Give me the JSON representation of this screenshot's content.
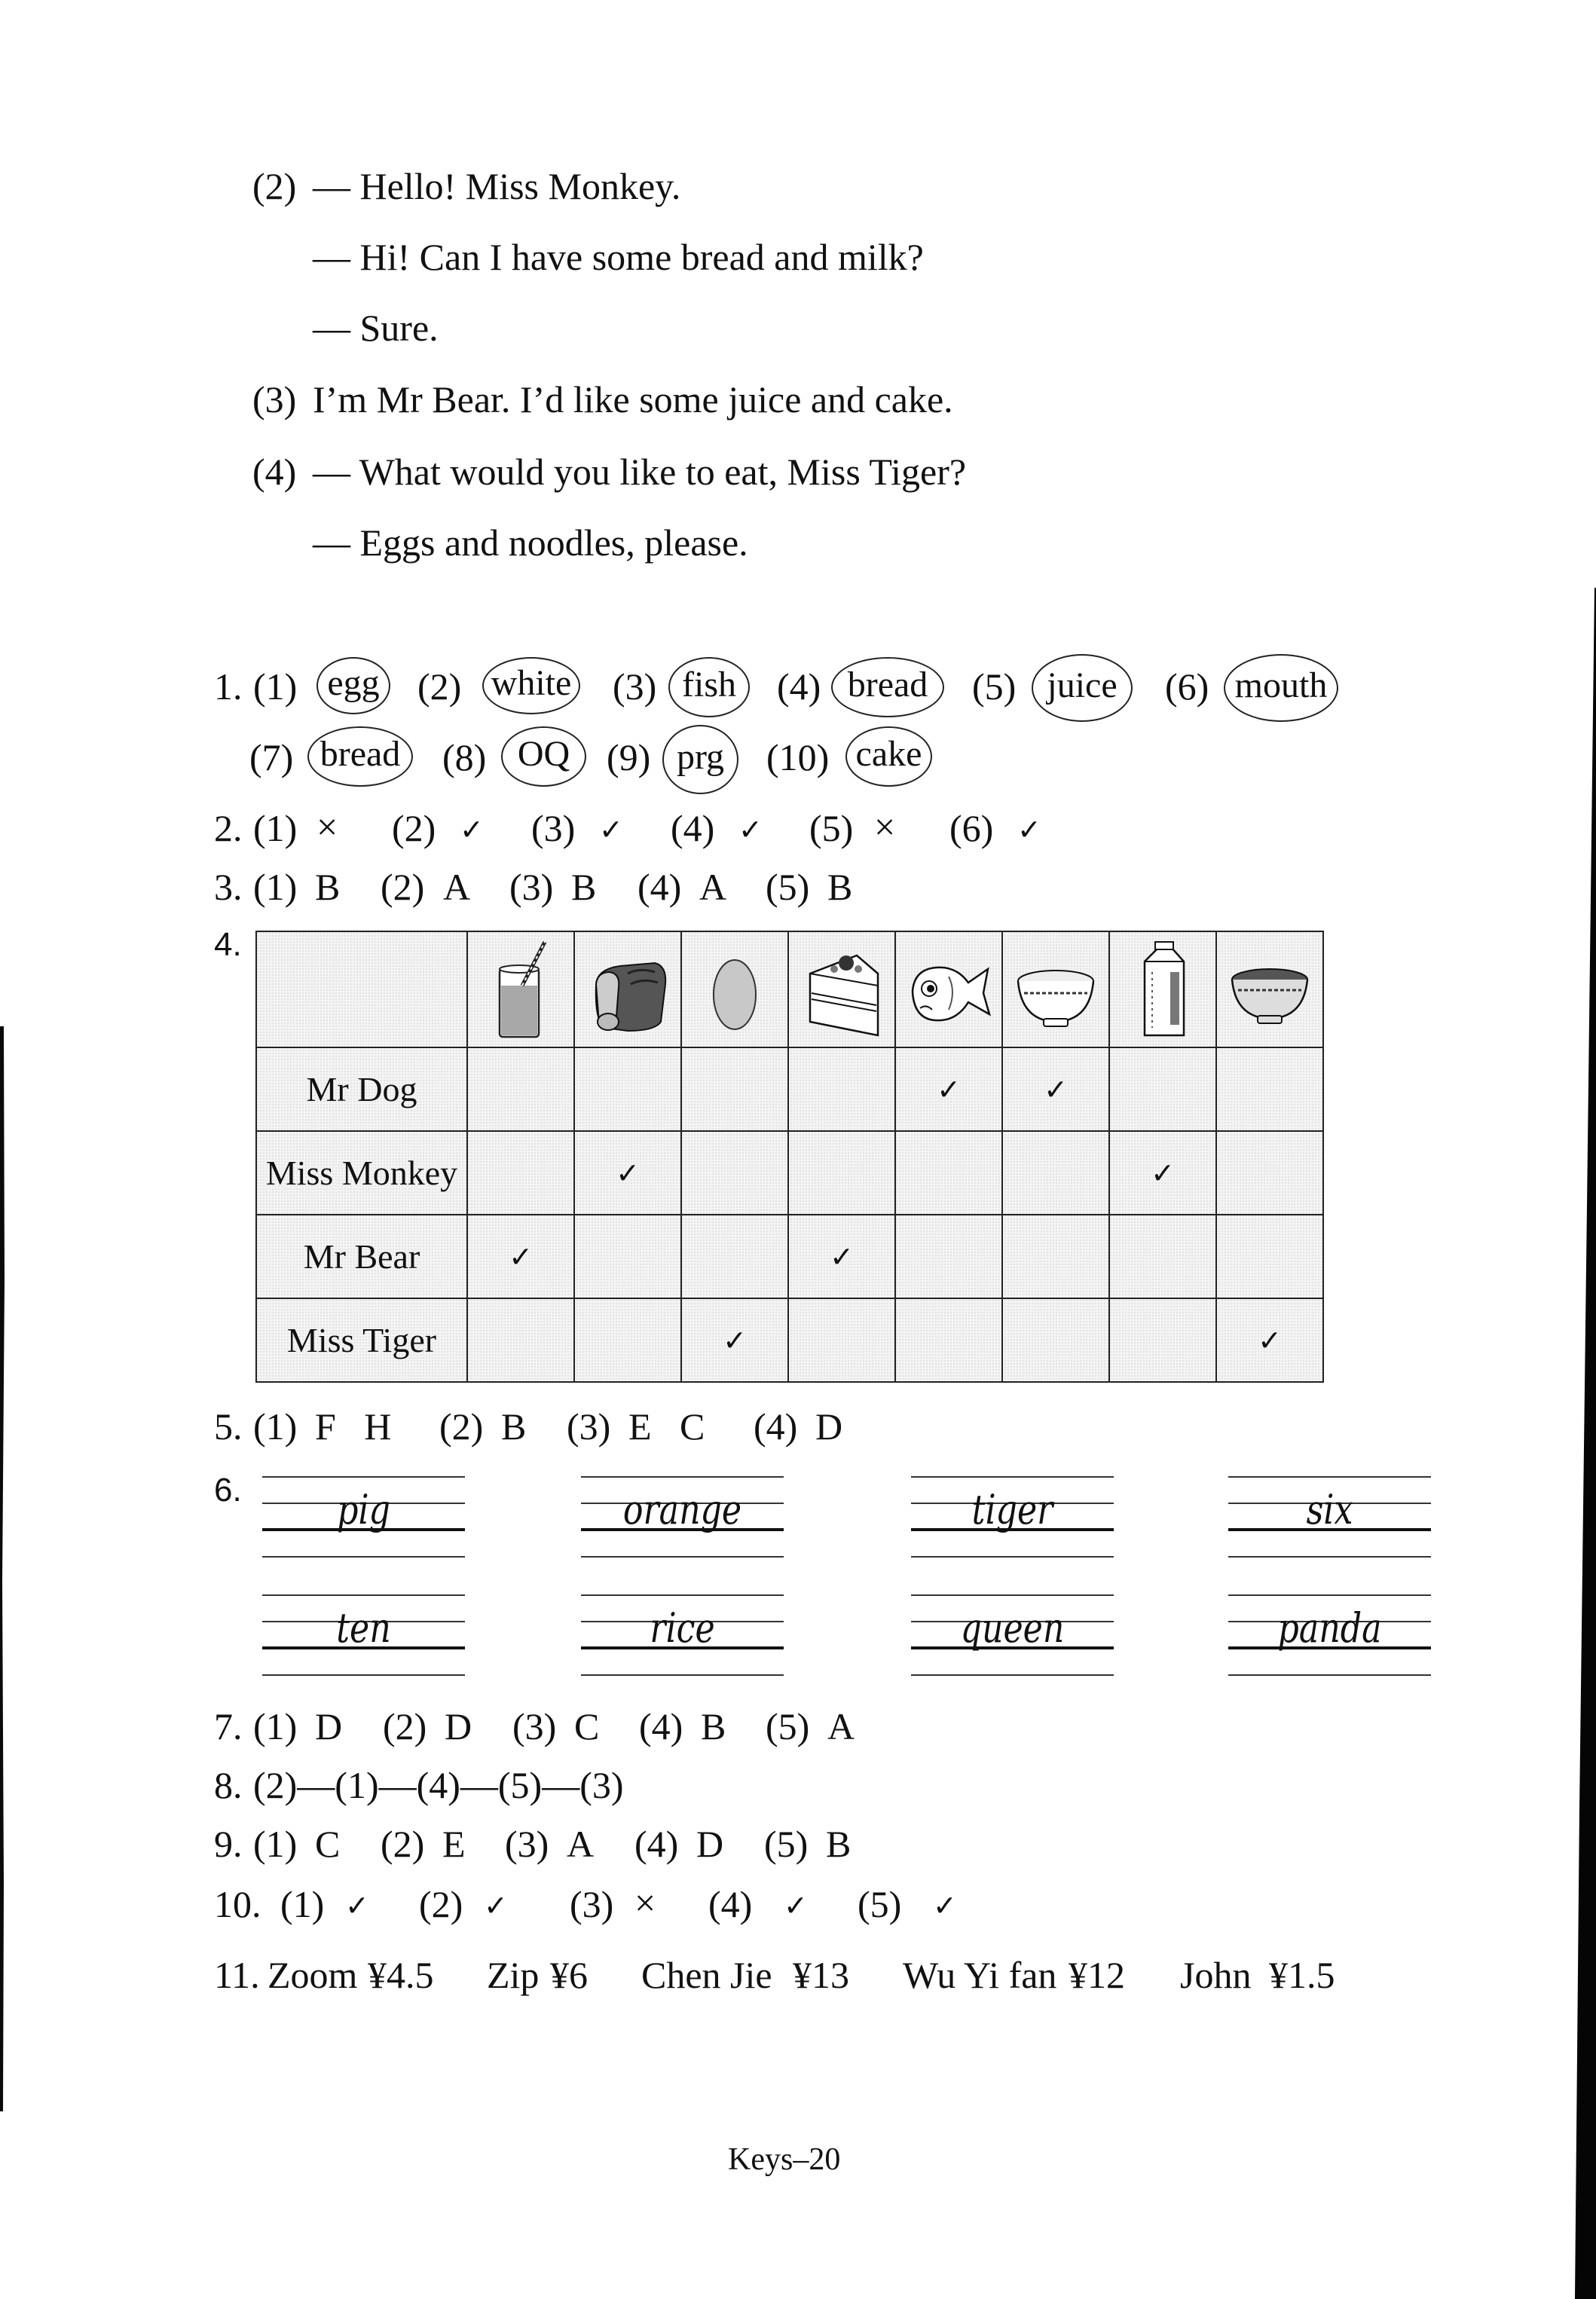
{
  "dialogue": [
    {
      "num": "(2)",
      "text": "— Hello! Miss Monkey."
    },
    {
      "num": "",
      "text": "— Hi! Can I have some bread and milk?"
    },
    {
      "num": "",
      "text": "— Sure."
    },
    {
      "num": "(3)",
      "text": "I’m Mr Bear. I’d like some juice and cake."
    },
    {
      "num": "(4)",
      "text": "— What would you like to eat, Miss Tiger?"
    },
    {
      "num": "",
      "text": "— Eggs and noodles, please."
    }
  ],
  "q1": {
    "label": "1.",
    "items": [
      {
        "num": "(1)",
        "word": "egg"
      },
      {
        "num": "(2)",
        "word": "white"
      },
      {
        "num": "(3)",
        "word": "fish"
      },
      {
        "num": "(4)",
        "word": "bread"
      },
      {
        "num": "(5)",
        "word": "juice"
      },
      {
        "num": "(6)",
        "word": "mouth"
      },
      {
        "num": "(7)",
        "word": "bread"
      },
      {
        "num": "(8)",
        "word": "OQ"
      },
      {
        "num": "(9)",
        "word": "prg"
      },
      {
        "num": "(10)",
        "word": "cake"
      }
    ]
  },
  "q2": {
    "label": "2.",
    "items": [
      {
        "num": "(1)",
        "answer": "×"
      },
      {
        "num": "(2)",
        "answer": "✓"
      },
      {
        "num": "(3)",
        "answer": "✓"
      },
      {
        "num": "(4)",
        "answer": "✓"
      },
      {
        "num": "(5)",
        "answer": "×"
      },
      {
        "num": "(6)",
        "answer": "✓"
      }
    ]
  },
  "q3": {
    "label": "3.",
    "items": [
      {
        "num": "(1)",
        "answer": "B"
      },
      {
        "num": "(2)",
        "answer": "A"
      },
      {
        "num": "(3)",
        "answer": "B"
      },
      {
        "num": "(4)",
        "answer": "A"
      },
      {
        "num": "(5)",
        "answer": "B"
      }
    ]
  },
  "q4": {
    "label": "4.",
    "foods": [
      "juice-icon",
      "bread-icon",
      "egg-icon",
      "cake-icon",
      "fish-icon",
      "rice-icon",
      "milk-icon",
      "noodles-icon"
    ],
    "check_mark": "✓",
    "rows": [
      {
        "name": "Mr Dog",
        "checks": [
          false,
          false,
          false,
          false,
          true,
          true,
          false,
          false
        ]
      },
      {
        "name": "Miss Monkey",
        "checks": [
          false,
          true,
          false,
          false,
          false,
          false,
          true,
          false
        ]
      },
      {
        "name": "Mr Bear",
        "checks": [
          true,
          false,
          false,
          true,
          false,
          false,
          false,
          false
        ]
      },
      {
        "name": "Miss Tiger",
        "checks": [
          false,
          false,
          true,
          false,
          false,
          false,
          false,
          true
        ]
      }
    ]
  },
  "q5": {
    "label": "5.",
    "items": [
      {
        "num": "(1)",
        "answer": "F   H"
      },
      {
        "num": "(2)",
        "answer": "B"
      },
      {
        "num": "(3)",
        "answer": "E   C"
      },
      {
        "num": "(4)",
        "answer": "D"
      }
    ]
  },
  "q6": {
    "label": "6.",
    "words": [
      "pig",
      "orange",
      "tiger",
      "six",
      "ten",
      "rice",
      "queen",
      "panda"
    ]
  },
  "q7": {
    "label": "7.",
    "items": [
      {
        "num": "(1)",
        "answer": "D"
      },
      {
        "num": "(2)",
        "answer": "D"
      },
      {
        "num": "(3)",
        "answer": "C"
      },
      {
        "num": "(4)",
        "answer": "B"
      },
      {
        "num": "(5)",
        "answer": "A"
      }
    ]
  },
  "q8": {
    "label": "8.",
    "text": "(2)—(1)—(4)—(5)—(3)"
  },
  "q9": {
    "label": "9.",
    "items": [
      {
        "num": "(1)",
        "answer": "C"
      },
      {
        "num": "(2)",
        "answer": "E"
      },
      {
        "num": "(3)",
        "answer": "A"
      },
      {
        "num": "(4)",
        "answer": "D"
      },
      {
        "num": "(5)",
        "answer": "B"
      }
    ]
  },
  "q10": {
    "label": "10.",
    "items": [
      {
        "num": "(1)",
        "answer": "✓"
      },
      {
        "num": "(2)",
        "answer": "✓"
      },
      {
        "num": "(3)",
        "answer": "×"
      },
      {
        "num": "(4)",
        "answer": "✓"
      },
      {
        "num": "(5)",
        "answer": "✓"
      }
    ]
  },
  "q11": {
    "label": "11.",
    "items": [
      {
        "name": "Zoom",
        "amount": "¥4.5"
      },
      {
        "name": "Zip",
        "amount": "¥6"
      },
      {
        "name": "Chen Jie",
        "amount": "¥13"
      },
      {
        "name": "Wu Yi fan",
        "amount": "¥12"
      },
      {
        "name": "John",
        "amount": "¥1.5"
      }
    ]
  },
  "footer": {
    "page_label": "Keys–20"
  }
}
